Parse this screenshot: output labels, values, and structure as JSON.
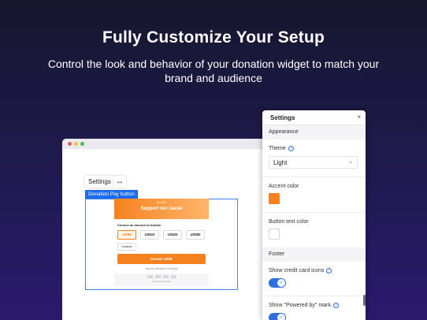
{
  "hero": {
    "title": "Fully Customize Your Setup",
    "subtitle": "Control the look and behavior of your donation widget to match your brand and audience"
  },
  "editor": {
    "settings_chip": "Settings",
    "move_icon": "↔",
    "selection_label": "Donation Pay button"
  },
  "widget": {
    "org": "Website",
    "title": "Support our cause",
    "choose_label": "Choose an amount to donate",
    "amounts": [
      "US$5",
      "US$10",
      "US$25",
      "US$50"
    ],
    "selected_amount": "US$5",
    "custom_label": "Custom",
    "donate_label": "Donate US$5",
    "secure_text": "Secure checkout via Stripe",
    "powered_text": "Powered by stripe"
  },
  "panel": {
    "title": "Settings",
    "close_icon": "×",
    "appearance_section": "Appearance",
    "theme_label": "Theme",
    "theme_value": "Light",
    "accent_label": "Accent color",
    "accent_color": "#f5821f",
    "button_text_label": "Button text color",
    "button_text_color": "#ffffff",
    "footer_section": "Footer",
    "show_cards_label": "Show credit card icons",
    "show_cards_on": true,
    "show_powered_label": "Show \"Powered by\" mark",
    "show_powered_on": true
  },
  "colors": {
    "accent": "#f5821f",
    "toggle": "#2f6fe0",
    "selection": "#1d6cf0"
  }
}
